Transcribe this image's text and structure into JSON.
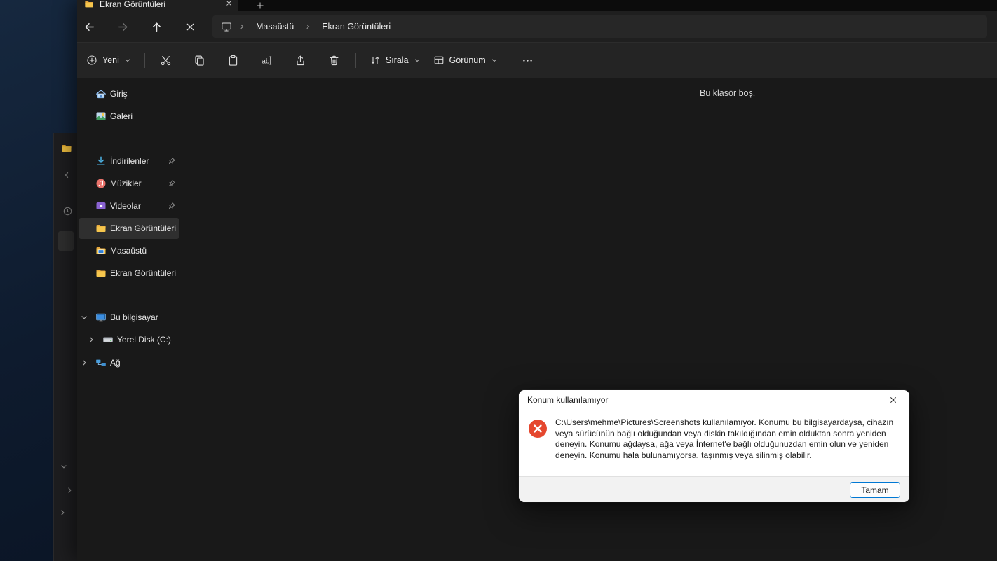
{
  "colors": {
    "accent": "#0078d4",
    "error_icon": "#e5472e",
    "folder_yellow": "#f6c64d",
    "window_bg": "#191919",
    "dialog_bg": "#ffffff"
  },
  "explorer": {
    "tab": {
      "title": "Ekran Görüntüleri"
    },
    "nav": {
      "breadcrumb": [
        "Masaüstü",
        "Ekran Görüntüleri"
      ]
    },
    "toolbar": {
      "new": "Yeni",
      "sort": "Sırala",
      "view": "Görünüm"
    },
    "sidebar": [
      {
        "label": "Giriş"
      },
      {
        "label": "Galeri"
      },
      {
        "label": "İndirilenler",
        "pinned": true
      },
      {
        "label": "Müzikler",
        "pinned": true
      },
      {
        "label": "Videolar",
        "pinned": true
      },
      {
        "label": "Ekran Görüntüleri",
        "selected": true
      },
      {
        "label": "Masaüstü"
      },
      {
        "label": "Ekran Görüntüleri"
      },
      {
        "label": "Bu bilgisayar",
        "expanded": true
      },
      {
        "label": "Yerel Disk (C:)",
        "collapsed": true
      },
      {
        "label": "Ağ",
        "collapsed": true
      }
    ],
    "content": {
      "empty_message": "Bu klasör boş."
    }
  },
  "dialog": {
    "title": "Konum kullanılamıyor",
    "message": "C:\\Users\\mehme\\Pictures\\Screenshots kullanılamıyor. Konumu bu bilgisayardaysa, cihazın veya sürücünün bağlı olduğundan veya diskin takıldığından emin olduktan sonra yeniden deneyin. Konumu ağdaysa, ağa veya İnternet'e bağlı olduğunuzdan emin olun ve yeniden deneyin. Konumu hala bulunamıyorsa, taşınmış veya silinmiş olabilir.",
    "ok": "Tamam"
  }
}
